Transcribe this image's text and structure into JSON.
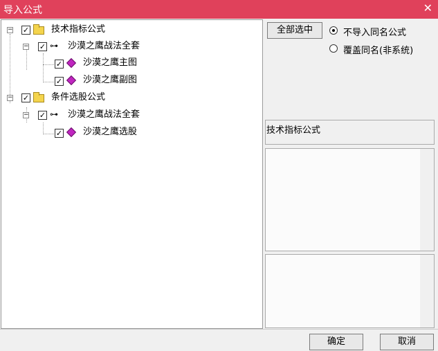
{
  "window": {
    "title": "导入公式",
    "close_icon": "close-icon"
  },
  "tree": {
    "root1": {
      "label": "技术指标公式",
      "checked": true,
      "expanded": true
    },
    "root1_child": {
      "label": "沙漠之鹰战法全套",
      "checked": true,
      "expanded": true
    },
    "root1_leaf1": {
      "label": "沙漠之鹰主图",
      "checked": true
    },
    "root1_leaf2": {
      "label": "沙漠之鹰副图",
      "checked": true
    },
    "root2": {
      "label": "条件选股公式",
      "checked": true,
      "expanded": true
    },
    "root2_child": {
      "label": "沙漠之鹰战法全套",
      "checked": true,
      "expanded": true
    },
    "root2_leaf1": {
      "label": "沙漠之鹰选股",
      "checked": true
    }
  },
  "options": {
    "select_all_label": "全部选中",
    "radio1_label": "不导入同名公式",
    "radio1_selected": true,
    "radio2_label": "覆盖同名(非系统)",
    "radio2_selected": false
  },
  "detail": {
    "category_label": "技术指标公式"
  },
  "footer": {
    "ok_label": "确定",
    "cancel_label": "取消"
  }
}
